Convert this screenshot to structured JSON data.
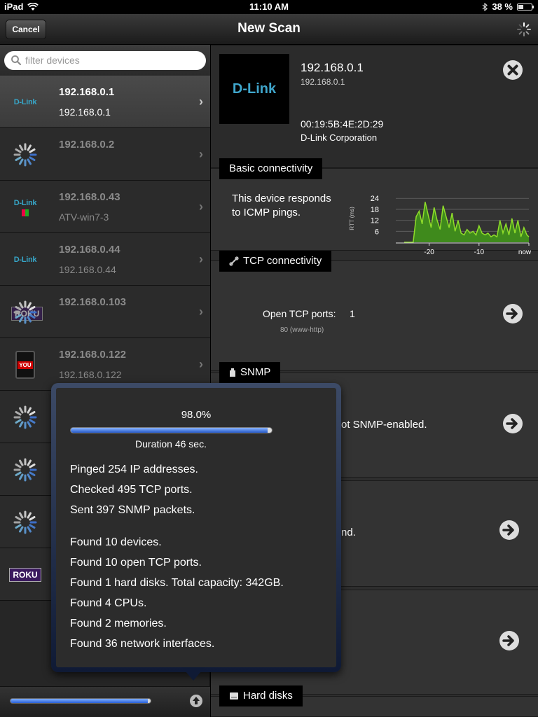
{
  "status_bar": {
    "device": "iPad",
    "time": "11:10 AM",
    "battery": "38 %",
    "battery_level": 0.38
  },
  "nav": {
    "title": "New Scan",
    "cancel_label": "Cancel"
  },
  "search": {
    "placeholder": "filter devices"
  },
  "devices": [
    {
      "ip": "192.168.0.1",
      "sub": "192.168.0.1",
      "icon": "dlink-icon",
      "logo_text": "D-Link",
      "selected": true
    },
    {
      "ip": "192.168.0.2",
      "sub": "",
      "icon": "spinner-icon",
      "selected": false
    },
    {
      "ip": "192.168.0.43",
      "sub": "ATV-win7-3",
      "icon": "dlink-windows-icon",
      "logo_text": "D-Link",
      "selected": false
    },
    {
      "ip": "192.168.0.44",
      "sub": "192.168.0.44",
      "icon": "dlink-icon",
      "logo_text": "D-Link",
      "selected": false
    },
    {
      "ip": "192.168.0.103",
      "sub": "",
      "icon": "roku-spinner-icon",
      "logo_text": "ROKU",
      "selected": false
    },
    {
      "ip": "192.168.0.122",
      "sub": "192.168.0.122",
      "icon": "tablet-icon",
      "logo_text": "YOU",
      "selected": false
    },
    {
      "ip": "",
      "sub": "",
      "icon": "spinner-icon",
      "selected": false
    },
    {
      "ip": "",
      "sub": "",
      "icon": "spinner-icon",
      "selected": false
    },
    {
      "ip": "",
      "sub": "",
      "icon": "spinner-icon",
      "selected": false
    },
    {
      "ip": "",
      "sub": "",
      "icon": "roku-icon",
      "logo_text": "ROKU",
      "selected": false
    }
  ],
  "bottom_progress": 0.98,
  "detail": {
    "logo_text": "D-Link",
    "title": "192.168.0.1",
    "subtitle": "192.168.0.1",
    "mac": "00:19:5B:4E:2D:29",
    "vendor": "D-Link Corporation",
    "basic_label": "Basic connectivity",
    "icmp_text": "This device responds to ICMP pings.",
    "tcp_label": "TCP connectivity",
    "tcp_ports_label": "Open TCP ports:",
    "tcp_ports_value": "1",
    "tcp_port_detail": "80 (www-http)",
    "snmp_label": "SNMP",
    "snmp_partial": "ot SNMP-enabled.",
    "other_partial": "nd.",
    "hard_disks_label": "Hard disks"
  },
  "chart_data": {
    "type": "area",
    "title": "",
    "xlabel": "",
    "ylabel": "RTT (ms)",
    "y_ticks": [
      24,
      18,
      12,
      6
    ],
    "x_tick_labels": [
      "-20",
      "-10",
      "now"
    ],
    "ylim": [
      0,
      26
    ],
    "xlim": [
      -25,
      0
    ],
    "grid": true,
    "color": "#8fdd2a",
    "x": [
      -25,
      -24.4,
      -23.8,
      -23.2,
      -22.6,
      -22,
      -21.4,
      -20.8,
      -20.2,
      -19.6,
      -19,
      -18.4,
      -17.8,
      -17.2,
      -16.6,
      -16,
      -15.4,
      -14.8,
      -14.2,
      -13.6,
      -13,
      -12.4,
      -11.8,
      -11.2,
      -10.6,
      -10,
      -9.4,
      -8.8,
      -8.2,
      -7.6,
      -7,
      -6.4,
      -5.8,
      -5.2,
      -4.6,
      -4,
      -3.4,
      -2.8,
      -2.2,
      -1.6,
      -1,
      -0.4,
      0
    ],
    "values": [
      0,
      0,
      0,
      0,
      14,
      17,
      10,
      22,
      15,
      8,
      19,
      12,
      7,
      20,
      14,
      8,
      16,
      6,
      12,
      5,
      4,
      7,
      5,
      6,
      4,
      9,
      5,
      4,
      5,
      3,
      4,
      3,
      12,
      5,
      10,
      4,
      13,
      5,
      12,
      3,
      8,
      4,
      3
    ]
  },
  "scan_popover": {
    "percent": "98.0%",
    "progress": 0.98,
    "duration": "Duration 46 sec.",
    "stats_a": [
      "Pinged 254 IP addresses.",
      "Checked 495 TCP ports.",
      "Sent 397 SNMP packets."
    ],
    "stats_b": [
      "Found 10 devices.",
      "Found 10 open TCP ports.",
      "Found 1 hard disks. Total capacity: 342GB.",
      "Found 4 CPUs.",
      "Found 2 memories.",
      "Found 36 network interfaces."
    ]
  }
}
